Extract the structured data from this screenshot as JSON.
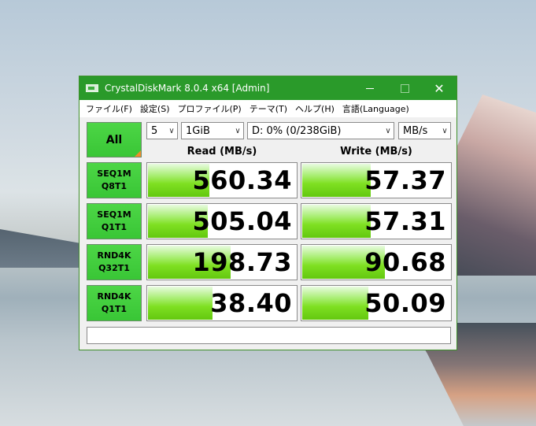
{
  "window": {
    "title": "CrystalDiskMark 8.0.4 x64 [Admin]"
  },
  "controls": {
    "minimize": "—",
    "maximize": "",
    "close": "✕"
  },
  "menu": [
    "ファイル(F)",
    "設定(S)",
    "プロファイル(P)",
    "テーマ(T)",
    "ヘルプ(H)",
    "言語(Language)"
  ],
  "all_button": "All",
  "selectors": {
    "count": "5",
    "size": "1GiB",
    "drive": "D: 0% (0/238GiB)",
    "unit": "MB/s"
  },
  "headers": {
    "read": "Read (MB/s)",
    "write": "Write (MB/s)"
  },
  "rows": [
    {
      "line1": "SEQ1M",
      "line2": "Q8T1",
      "read": "560.34",
      "write": "57.37",
      "read_fill": 0.41,
      "write_fill": 0.46
    },
    {
      "line1": "SEQ1M",
      "line2": "Q1T1",
      "read": "505.04",
      "write": "57.31",
      "read_fill": 0.4,
      "write_fill": 0.46
    },
    {
      "line1": "RND4K",
      "line2": "Q32T1",
      "read": "198.73",
      "write": "90.68",
      "read_fill": 0.55,
      "write_fill": 0.55
    },
    {
      "line1": "RND4K",
      "line2": "Q1T1",
      "read": "38.40",
      "write": "50.09",
      "read_fill": 0.43,
      "write_fill": 0.44
    }
  ],
  "status_text": "",
  "colors": {
    "titlebar": "#2a9a2a",
    "button_green": "#39c636",
    "bar_green": "#7fe022",
    "corner_orange": "#f18b2b"
  }
}
